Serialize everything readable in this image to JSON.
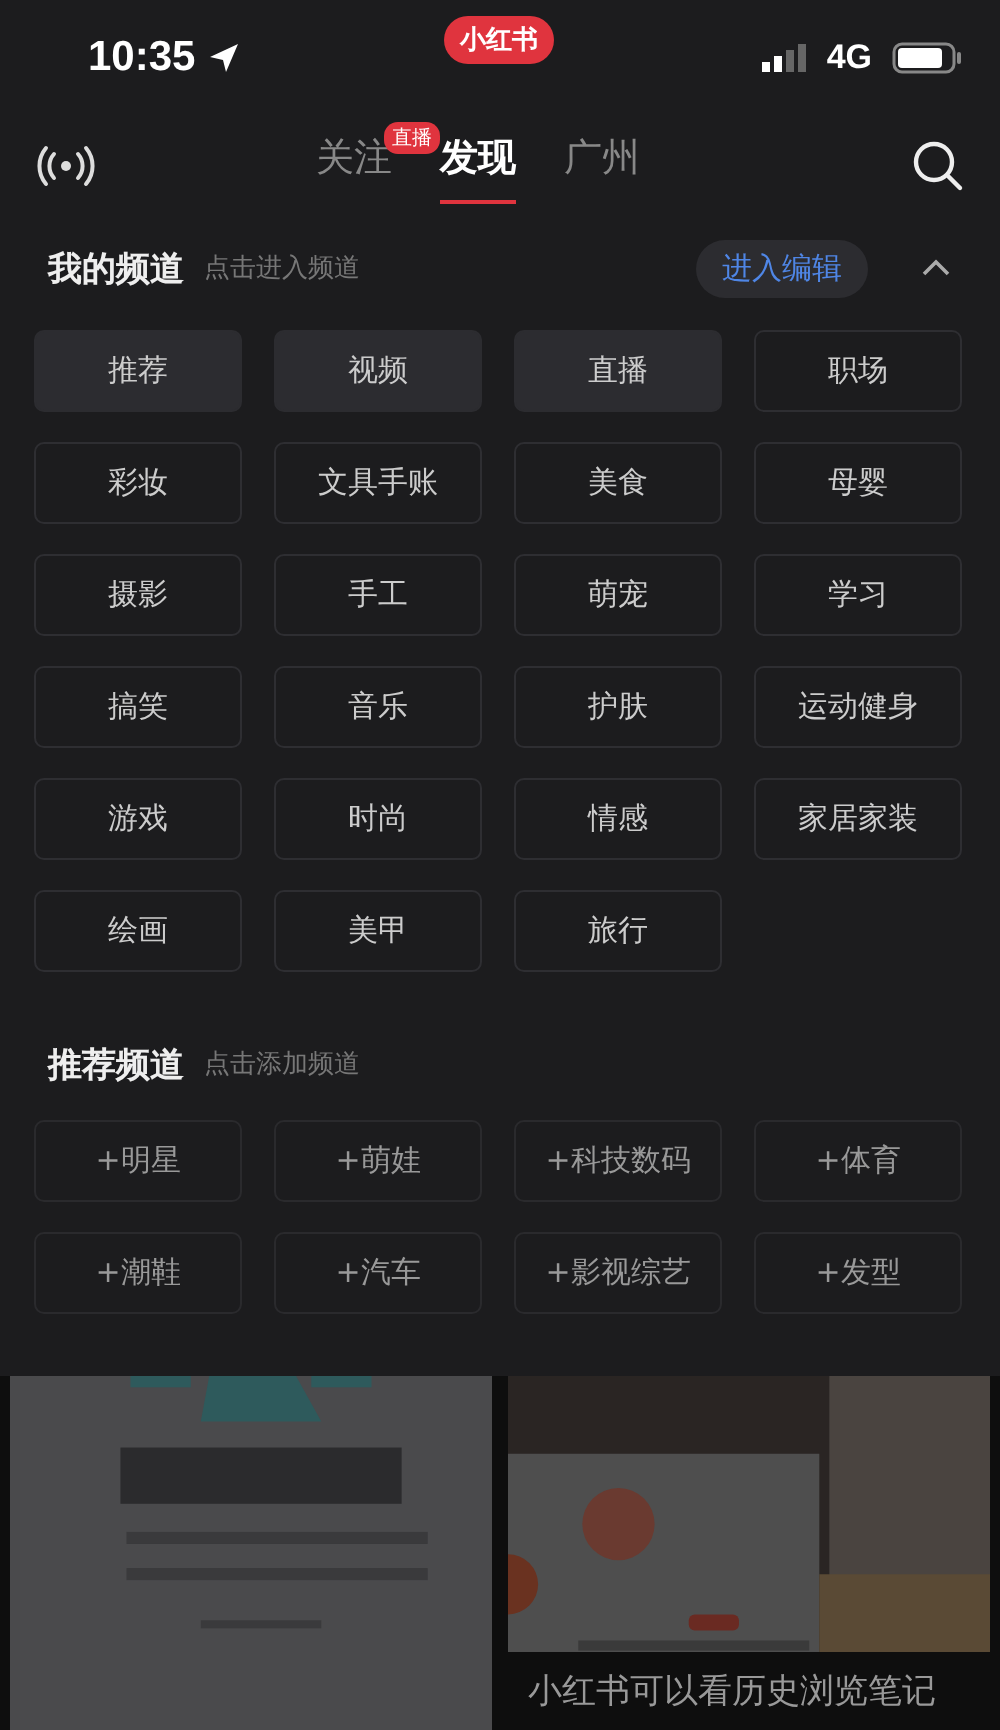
{
  "status_bar": {
    "time": "10:35",
    "app_badge": "小红书",
    "network": "4G"
  },
  "nav": {
    "tabs": [
      {
        "label": "关注",
        "selected": false,
        "badge": "直播"
      },
      {
        "label": "发现",
        "selected": true
      },
      {
        "label": "广州",
        "selected": false
      }
    ]
  },
  "my_channels": {
    "title": "我的频道",
    "hint": "点击进入频道",
    "edit_button": "进入编辑",
    "expanded": true,
    "items": [
      {
        "label": "推荐",
        "fixed": true
      },
      {
        "label": "视频",
        "fixed": true
      },
      {
        "label": "直播",
        "fixed": true
      },
      {
        "label": "职场",
        "fixed": false
      },
      {
        "label": "彩妆",
        "fixed": false
      },
      {
        "label": "文具手账",
        "fixed": false
      },
      {
        "label": "美食",
        "fixed": false
      },
      {
        "label": "母婴",
        "fixed": false
      },
      {
        "label": "摄影",
        "fixed": false
      },
      {
        "label": "手工",
        "fixed": false
      },
      {
        "label": "萌宠",
        "fixed": false
      },
      {
        "label": "学习",
        "fixed": false
      },
      {
        "label": "搞笑",
        "fixed": false
      },
      {
        "label": "音乐",
        "fixed": false
      },
      {
        "label": "护肤",
        "fixed": false
      },
      {
        "label": "运动健身",
        "fixed": false
      },
      {
        "label": "游戏",
        "fixed": false
      },
      {
        "label": "时尚",
        "fixed": false
      },
      {
        "label": "情感",
        "fixed": false
      },
      {
        "label": "家居家装",
        "fixed": false
      },
      {
        "label": "绘画",
        "fixed": false
      },
      {
        "label": "美甲",
        "fixed": false
      },
      {
        "label": "旅行",
        "fixed": false
      }
    ]
  },
  "recommended_channels": {
    "title": "推荐频道",
    "hint": "点击添加频道",
    "items": [
      "+明星",
      "+萌娃",
      "+科技数码",
      "+体育",
      "+潮鞋",
      "+汽车",
      "+影视综艺",
      "+发型"
    ]
  },
  "feed": [
    {
      "kind": "picture"
    },
    {
      "kind": "picture",
      "caption": "小红书可以看历史浏览笔记"
    }
  ]
}
